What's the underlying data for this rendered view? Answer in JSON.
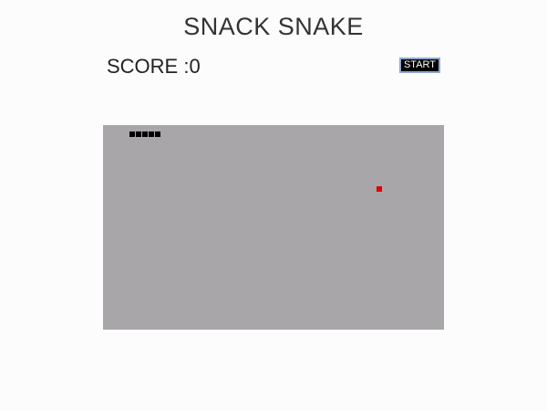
{
  "game": {
    "title": "SNACK SNAKE",
    "score_text": "SCORE :0",
    "start_label": "START"
  },
  "board": {
    "background": "#a8a6a8",
    "snake_color": "#000000",
    "food_color": "#e00000",
    "snake_length": 5
  }
}
